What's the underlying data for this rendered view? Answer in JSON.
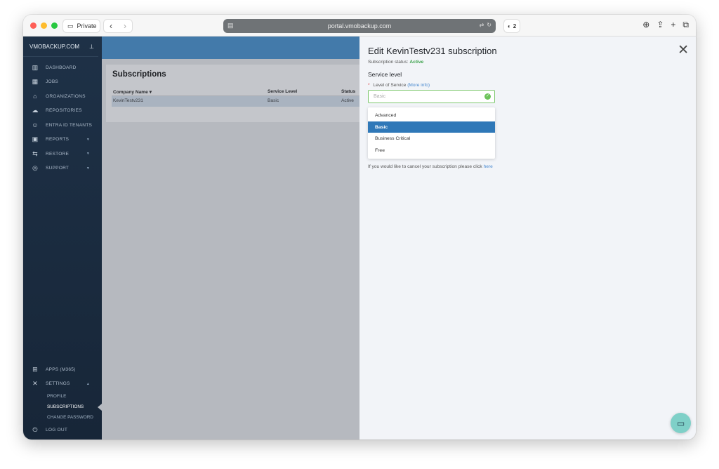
{
  "browser": {
    "private_label": "Private",
    "url": "portal.vmobackup.com",
    "extension_badge": "2"
  },
  "sidebar": {
    "brand": "VMOBACKUP.COM",
    "items": [
      {
        "label": "DASHBOARD",
        "icon": "bar-chart-icon"
      },
      {
        "label": "JOBS",
        "icon": "windows-icon"
      },
      {
        "label": "ORGANIZATIONS",
        "icon": "bank-icon"
      },
      {
        "label": "REPOSITORIES",
        "icon": "cloud-icon"
      },
      {
        "label": "ENTRA ID TENANTS",
        "icon": "user-icon"
      },
      {
        "label": "REPORTS",
        "icon": "report-icon"
      },
      {
        "label": "RESTORE",
        "icon": "restore-icon"
      },
      {
        "label": "SUPPORT",
        "icon": "globe-icon"
      }
    ],
    "bottom": {
      "apps": "APPS (M365)",
      "settings": "SETTINGS",
      "profile": "PROFILE",
      "subscriptions": "SUBSCRIPTIONS",
      "change_password": "CHANGE PASSWORD",
      "logout": "LOG OUT"
    }
  },
  "main": {
    "title": "Subscriptions",
    "columns": [
      "Company Name",
      "Service Level",
      "Status"
    ],
    "rows": [
      {
        "company": "KevinTestv231",
        "service_level": "Basic",
        "status": "Active"
      }
    ]
  },
  "panel": {
    "title": "Edit KevinTestv231 subscription",
    "status_label": "Subscription status:",
    "status_value": "Active",
    "section": "Service level",
    "field_label": "Level of Service",
    "more_info": "(More info)",
    "select_value": "Basic",
    "options": [
      "Advanced",
      "Basic",
      "Business Critical",
      "Free"
    ],
    "selected_index": 1,
    "cancel_text": "If you would like to cancel your subscription please click",
    "cancel_link": "here"
  },
  "colors": {
    "sidebar_bg": "#1e3147",
    "accent": "#2f78b8",
    "active_green": "#3aa14a",
    "chat_button": "#7fd0c8"
  }
}
